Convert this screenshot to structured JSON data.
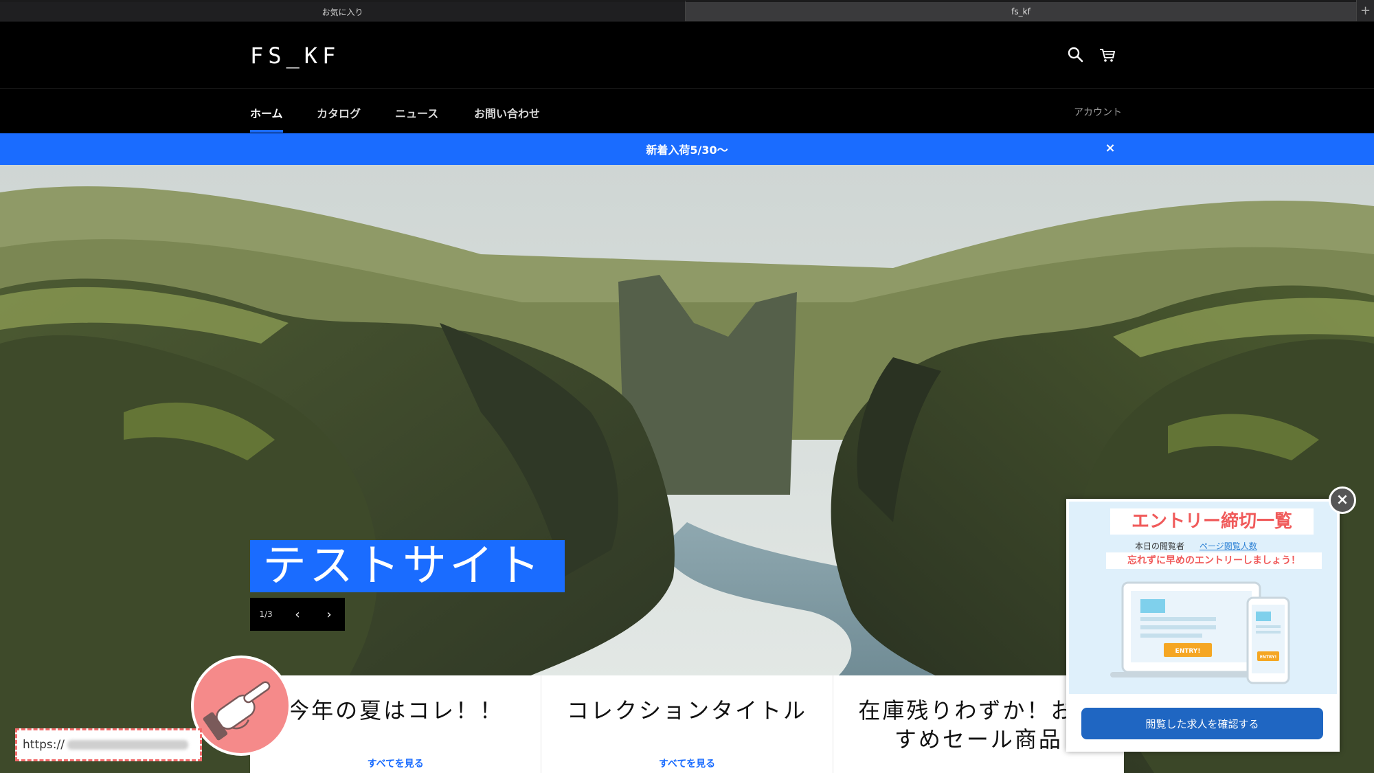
{
  "browser": {
    "tabs": [
      {
        "label": "お気に入り"
      },
      {
        "label": "fs_kf"
      }
    ],
    "add_tab": "+"
  },
  "header": {
    "logo": "FS_KF"
  },
  "nav": {
    "items": [
      {
        "label": "ホーム"
      },
      {
        "label": "カタログ"
      },
      {
        "label": "ニュース"
      },
      {
        "label": "お問い合わせ"
      }
    ],
    "account": "アカウント"
  },
  "announcement": {
    "text": "新着入荷5/30〜",
    "close": "×"
  },
  "hero": {
    "title": "テストサイト",
    "slide_counter": "1/3",
    "prev": "‹",
    "next": "›"
  },
  "collections": [
    {
      "title": "今年の夏はコレ！！",
      "link": "すべてを見る"
    },
    {
      "title": "コレクションタイトル",
      "link": "すべてを見る"
    },
    {
      "title": "在庫残りわずか！おすすめセール商品",
      "link": ""
    }
  ],
  "popup": {
    "heading": "エントリー締切一覧",
    "sub_label": "本日の閲覧者",
    "sub_link": "ページ閲覧人数",
    "reminder": "忘れずに早めのエントリーしましょう！",
    "entry_label": "ENTRY!",
    "button": "閲覧した求人を確認する",
    "close": "×"
  },
  "status_bar": {
    "url_prefix": "https://"
  },
  "colors": {
    "accent": "#1a6cff",
    "popup_heading": "#f05a5a",
    "popup_button": "#1f66c2"
  }
}
